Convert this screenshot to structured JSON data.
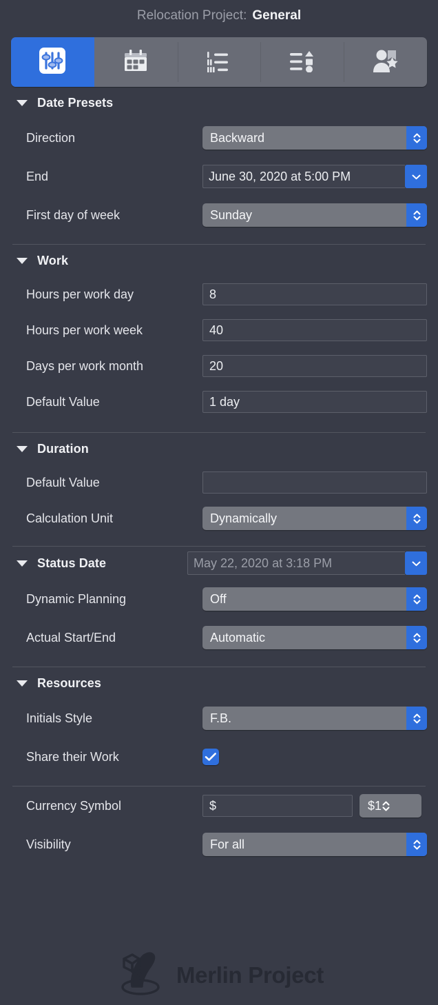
{
  "header": {
    "project_label": "Relocation Project:",
    "page_name": "General"
  },
  "toolbar": {
    "tabs": [
      {
        "name": "general",
        "icon": "sliders-icon",
        "active": true
      },
      {
        "name": "calendar",
        "icon": "calendar-icon",
        "active": false
      },
      {
        "name": "outline",
        "icon": "list-numbered-icon",
        "active": false
      },
      {
        "name": "shapes",
        "icon": "list-shapes-icon",
        "active": false
      },
      {
        "name": "resources",
        "icon": "person-star-icon",
        "active": false
      }
    ]
  },
  "sections": {
    "date_presets": {
      "title": "Date Presets",
      "direction": {
        "label": "Direction",
        "value": "Backward"
      },
      "end": {
        "label": "End",
        "value": "June 30, 2020 at 5:00 PM"
      },
      "first_day": {
        "label": "First day of week",
        "value": "Sunday"
      }
    },
    "work": {
      "title": "Work",
      "hours_per_day": {
        "label": "Hours per work day",
        "value": "8"
      },
      "hours_per_week": {
        "label": "Hours per work week",
        "value": "40"
      },
      "days_per_month": {
        "label": "Days per work month",
        "value": "20"
      },
      "default_value": {
        "label": "Default Value",
        "value": "1 day"
      }
    },
    "duration": {
      "title": "Duration",
      "default_value": {
        "label": "Default Value",
        "value": ""
      },
      "calculation_unit": {
        "label": "Calculation Unit",
        "value": "Dynamically"
      }
    },
    "status_date": {
      "title": "Status Date",
      "value": "May 22, 2020 at 3:18 PM",
      "dynamic_planning": {
        "label": "Dynamic Planning",
        "value": "Off"
      },
      "actual_start_end": {
        "label": "Actual Start/End",
        "value": "Automatic"
      }
    },
    "resources": {
      "title": "Resources",
      "initials_style": {
        "label": "Initials Style",
        "value": "F.B."
      },
      "share_their_work": {
        "label": "Share their Work",
        "checked": true
      }
    },
    "currency": {
      "symbol": {
        "label": "Currency Symbol",
        "value": "$"
      },
      "format": {
        "value": "$1"
      },
      "visibility": {
        "label": "Visibility",
        "value": "For all"
      }
    }
  },
  "footer": {
    "wordmark": "Merlin Project",
    "logo_icon": "merlin-hat-icon"
  },
  "colors": {
    "background": "#383b47",
    "accent_blue": "#2f6fdd",
    "popup_grey": "#74777f",
    "segmented_grey": "#696c76",
    "field_dark": "#3e414d",
    "divider": "#52555f"
  }
}
